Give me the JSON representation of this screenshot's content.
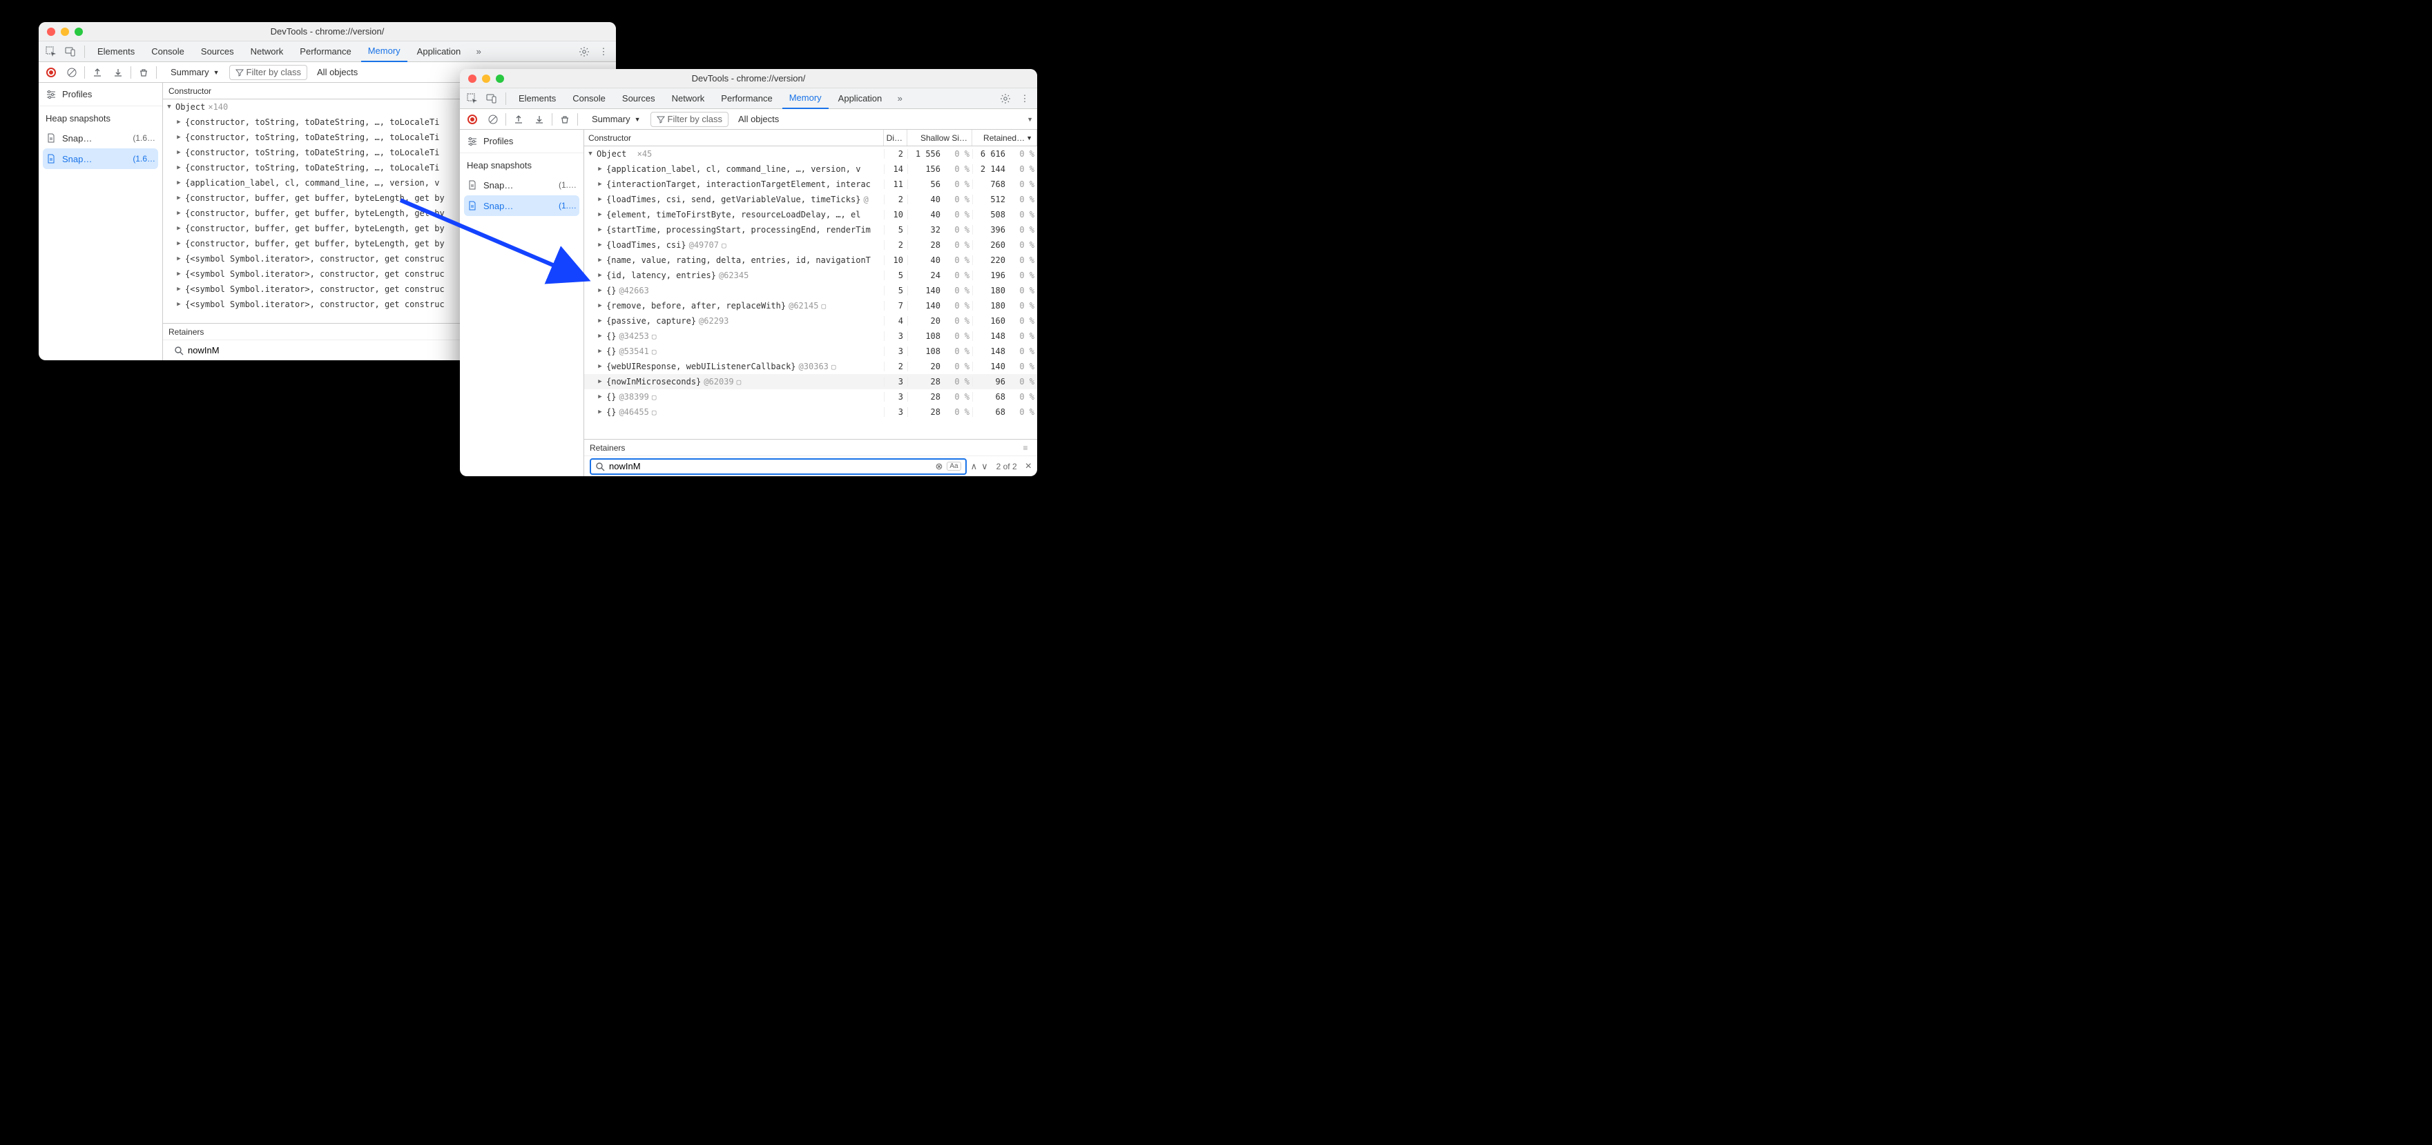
{
  "win1": {
    "title": "DevTools - chrome://version/",
    "tabs": [
      "Elements",
      "Console",
      "Sources",
      "Network",
      "Performance",
      "Memory",
      "Application"
    ],
    "active_tab": "Memory",
    "summary_label": "Summary",
    "filter_placeholder": "Filter by class",
    "all_objects_label": "All objects",
    "profiles_label": "Profiles",
    "heap_label": "Heap snapshots",
    "snaps": [
      {
        "name": "Snap…",
        "size": "(1.6…"
      },
      {
        "name": "Snap…",
        "size": "(1.6…"
      }
    ],
    "constructor_label": "Constructor",
    "root_label": "Object",
    "root_count": "×140",
    "rows": [
      "{constructor, toString, toDateString, …, toLocaleTi",
      "{constructor, toString, toDateString, …, toLocaleTi",
      "{constructor, toString, toDateString, …, toLocaleTi",
      "{constructor, toString, toDateString, …, toLocaleTi",
      "{application_label, cl, command_line, …, version, v",
      "{constructor, buffer, get buffer, byteLength, get by",
      "{constructor, buffer, get buffer, byteLength, get by",
      "{constructor, buffer, get buffer, byteLength, get by",
      "{constructor, buffer, get buffer, byteLength, get by",
      "{<symbol Symbol.iterator>, constructor, get construc",
      "{<symbol Symbol.iterator>, constructor, get construc",
      "{<symbol Symbol.iterator>, constructor, get construc",
      "{<symbol Symbol.iterator>, constructor, get construc"
    ],
    "retainers_label": "Retainers",
    "search_value": "nowInM"
  },
  "win2": {
    "title": "DevTools - chrome://version/",
    "tabs": [
      "Elements",
      "Console",
      "Sources",
      "Network",
      "Performance",
      "Memory",
      "Application"
    ],
    "active_tab": "Memory",
    "summary_label": "Summary",
    "filter_placeholder": "Filter by class",
    "all_objects_label": "All objects",
    "profiles_label": "Profiles",
    "heap_label": "Heap snapshots",
    "snaps": [
      {
        "name": "Snap…",
        "size": "(1.…"
      },
      {
        "name": "Snap…",
        "size": "(1.…"
      }
    ],
    "cols": [
      "Constructor",
      "Di…",
      "Shallow Si…",
      "Retained…"
    ],
    "root_label": "Object",
    "root_count": "×45",
    "root_vals": {
      "d": "2",
      "s": "1 556",
      "sp": "0 %",
      "r": "6 616",
      "rp": "0 %"
    },
    "rows": [
      {
        "t": "{application_label, cl, command_line, …, version, v",
        "d": "14",
        "s": "156",
        "sp": "0 %",
        "r": "2 144",
        "rp": "0 %"
      },
      {
        "t": "{interactionTarget, interactionTargetElement, interac",
        "d": "11",
        "s": "56",
        "sp": "0 %",
        "r": "768",
        "rp": "0 %"
      },
      {
        "t": "{loadTimes, csi, send, getVariableValue, timeTicks}",
        "ref": "@",
        "d": "2",
        "s": "40",
        "sp": "0 %",
        "r": "512",
        "rp": "0 %"
      },
      {
        "t": "{element, timeToFirstByte, resourceLoadDelay, …, el",
        "d": "10",
        "s": "40",
        "sp": "0 %",
        "r": "508",
        "rp": "0 %"
      },
      {
        "t": "{startTime, processingStart, processingEnd, renderTim",
        "d": "5",
        "s": "32",
        "sp": "0 %",
        "r": "396",
        "rp": "0 %"
      },
      {
        "t": "{loadTimes, csi}",
        "ref": "@49707",
        "save": true,
        "d": "2",
        "s": "28",
        "sp": "0 %",
        "r": "260",
        "rp": "0 %"
      },
      {
        "t": "{name, value, rating, delta, entries, id, navigationT",
        "d": "10",
        "s": "40",
        "sp": "0 %",
        "r": "220",
        "rp": "0 %"
      },
      {
        "t": "{id, latency, entries}",
        "ref": "@62345",
        "d": "5",
        "s": "24",
        "sp": "0 %",
        "r": "196",
        "rp": "0 %"
      },
      {
        "t": "{}",
        "ref": "@42663",
        "d": "5",
        "s": "140",
        "sp": "0 %",
        "r": "180",
        "rp": "0 %"
      },
      {
        "t": "{remove, before, after, replaceWith}",
        "ref": "@62145",
        "save": true,
        "d": "7",
        "s": "140",
        "sp": "0 %",
        "r": "180",
        "rp": "0 %"
      },
      {
        "t": "{passive, capture}",
        "ref": "@62293",
        "d": "4",
        "s": "20",
        "sp": "0 %",
        "r": "160",
        "rp": "0 %"
      },
      {
        "t": "{}",
        "ref": "@34253",
        "save": true,
        "d": "3",
        "s": "108",
        "sp": "0 %",
        "r": "148",
        "rp": "0 %"
      },
      {
        "t": "{}",
        "ref": "@53541",
        "save": true,
        "d": "3",
        "s": "108",
        "sp": "0 %",
        "r": "148",
        "rp": "0 %"
      },
      {
        "t": "{webUIResponse, webUIListenerCallback}",
        "ref": "@30363",
        "save": true,
        "d": "2",
        "s": "20",
        "sp": "0 %",
        "r": "140",
        "rp": "0 %"
      },
      {
        "t": "{nowInMicroseconds}",
        "ref": "@62039",
        "save": true,
        "d": "3",
        "s": "28",
        "sp": "0 %",
        "r": "96",
        "rp": "0 %",
        "hl": true
      },
      {
        "t": "{}",
        "ref": "@38399",
        "save": true,
        "d": "3",
        "s": "28",
        "sp": "0 %",
        "r": "68",
        "rp": "0 %"
      },
      {
        "t": "{}",
        "ref": "@46455",
        "save": true,
        "d": "3",
        "s": "28",
        "sp": "0 %",
        "r": "68",
        "rp": "0 %"
      }
    ],
    "retainers_label": "Retainers",
    "search_value": "nowInM",
    "match_counter": "2 of 2"
  }
}
